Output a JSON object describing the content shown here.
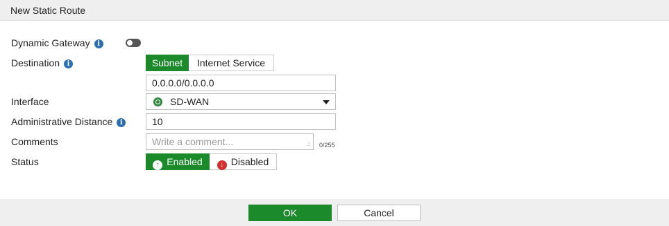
{
  "dialog": {
    "title": "New Static Route"
  },
  "form": {
    "dynamic_gateway_label": "Dynamic Gateway",
    "dynamic_gateway_enabled": false,
    "destination_label": "Destination",
    "destination_options": [
      "Subnet",
      "Internet Service"
    ],
    "destination_selected": "Subnet",
    "subnet_value": "0.0.0.0/0.0.0.0",
    "interface_label": "Interface",
    "interface_value": "SD-WAN",
    "admin_distance_label": "Administrative Distance",
    "admin_distance_value": "10",
    "comments_label": "Comments",
    "comments_placeholder": "Write a comment...",
    "comments_counter": "0/255",
    "status_label": "Status",
    "status_options": [
      "Enabled",
      "Disabled"
    ],
    "status_selected": "Enabled"
  },
  "footer": {
    "ok_label": "OK",
    "cancel_label": "Cancel"
  },
  "colors": {
    "accent": "#1a8a2a",
    "info": "#2a6fb6",
    "danger": "#d32f2f"
  },
  "icons": {
    "info": "info-icon",
    "interface": "sdwan-icon",
    "enabled": "arrow-up-circle-icon",
    "disabled": "arrow-down-circle-icon"
  }
}
